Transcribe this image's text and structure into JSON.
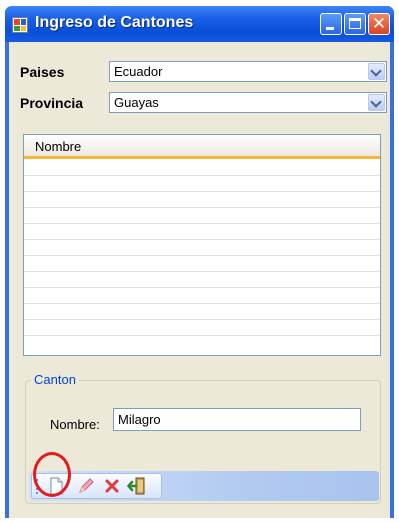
{
  "window": {
    "title": "Ingreso de Cantones"
  },
  "paises": {
    "label": "Paises",
    "value": "Ecuador"
  },
  "provincia": {
    "label": "Provincia",
    "value": "Guayas"
  },
  "grid": {
    "columns": [
      "Nombre"
    ],
    "rows": []
  },
  "canton_group": {
    "title": "Canton",
    "nombre_label": "Nombre:",
    "nombre_value": "Milagro"
  },
  "toolbar": {
    "items": [
      "new-icon",
      "edit-icon",
      "delete-icon",
      "exit-icon"
    ]
  },
  "annotation": {
    "color": "#e31b1b",
    "shape": "circle"
  },
  "colors": {
    "titlebar": "#0a4fd8",
    "client": "#ece9d8",
    "header_accent": "#f8b43a",
    "groupbox_title": "#0046d5"
  }
}
